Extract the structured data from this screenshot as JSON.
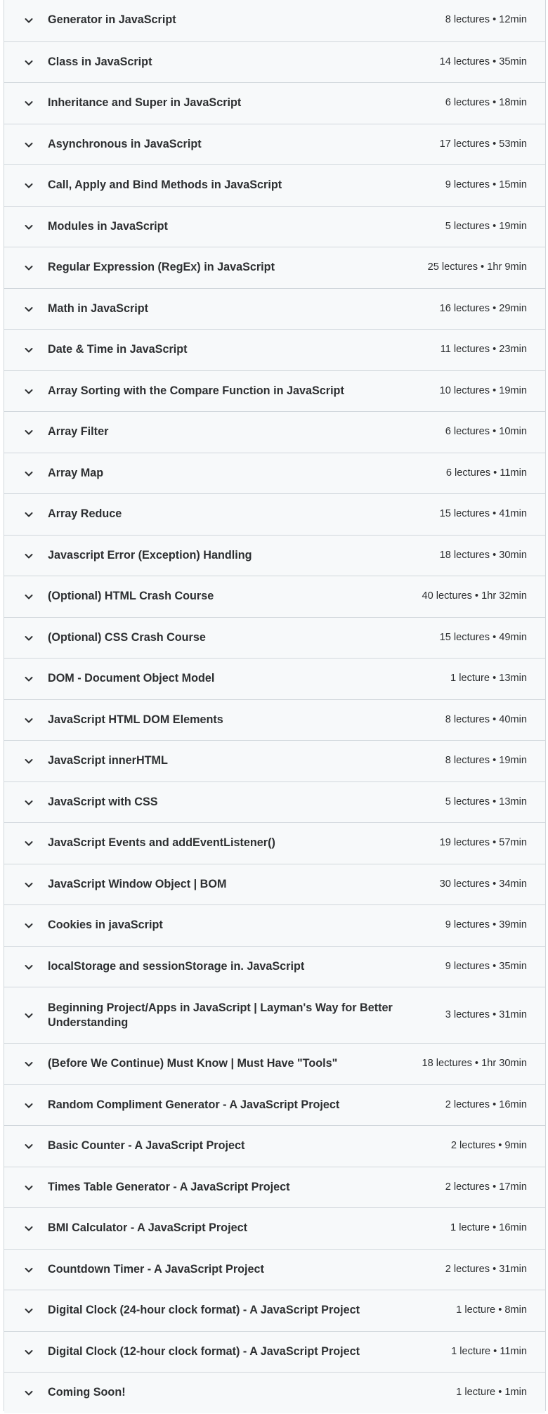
{
  "curriculum": {
    "icon": "chevron-down-icon",
    "sections": [
      {
        "title": "Generator in JavaScript",
        "meta": "8 lectures • 12min"
      },
      {
        "title": "Class in JavaScript",
        "meta": "14 lectures • 35min"
      },
      {
        "title": "Inheritance and Super in JavaScript",
        "meta": "6 lectures • 18min"
      },
      {
        "title": "Asynchronous in JavaScript",
        "meta": "17 lectures • 53min"
      },
      {
        "title": "Call, Apply and Bind Methods in JavaScript",
        "meta": "9 lectures • 15min"
      },
      {
        "title": "Modules in JavaScript",
        "meta": "5 lectures • 19min"
      },
      {
        "title": "Regular Expression (RegEx) in JavaScript",
        "meta": "25 lectures • 1hr 9min"
      },
      {
        "title": "Math in JavaScript",
        "meta": "16 lectures • 29min"
      },
      {
        "title": "Date & Time in JavaScript",
        "meta": "11 lectures • 23min"
      },
      {
        "title": "Array Sorting with the Compare Function in JavaScript",
        "meta": "10 lectures • 19min"
      },
      {
        "title": "Array Filter",
        "meta": "6 lectures • 10min"
      },
      {
        "title": "Array Map",
        "meta": "6 lectures • 11min"
      },
      {
        "title": "Array Reduce",
        "meta": "15 lectures • 41min"
      },
      {
        "title": "Javascript Error (Exception) Handling",
        "meta": "18 lectures • 30min"
      },
      {
        "title": "(Optional) HTML Crash Course",
        "meta": "40 lectures • 1hr 32min"
      },
      {
        "title": "(Optional) CSS Crash Course",
        "meta": "15 lectures • 49min"
      },
      {
        "title": "DOM - Document Object Model",
        "meta": "1 lecture • 13min"
      },
      {
        "title": "JavaScript HTML DOM Elements",
        "meta": "8 lectures • 40min"
      },
      {
        "title": "JavaScript innerHTML",
        "meta": "8 lectures • 19min"
      },
      {
        "title": "JavaScript with CSS",
        "meta": "5 lectures • 13min"
      },
      {
        "title": "JavaScript Events and addEventListener()",
        "meta": "19 lectures • 57min"
      },
      {
        "title": "JavaScript Window Object | BOM",
        "meta": "30 lectures • 34min"
      },
      {
        "title": "Cookies in javaScript",
        "meta": "9 lectures • 39min"
      },
      {
        "title": "localStorage and sessionStorage in. JavaScript",
        "meta": "9 lectures • 35min"
      },
      {
        "title": "Beginning Project/Apps in JavaScript | Layman's Way for Better Understanding",
        "meta": "3 lectures • 31min"
      },
      {
        "title": "(Before We Continue) Must Know | Must Have \"Tools\"",
        "meta": "18 lectures • 1hr 30min"
      },
      {
        "title": "Random Compliment Generator - A JavaScript Project",
        "meta": "2 lectures • 16min"
      },
      {
        "title": "Basic Counter - A JavaScript Project",
        "meta": "2 lectures • 9min"
      },
      {
        "title": "Times Table Generator - A JavaScript Project",
        "meta": "2 lectures • 17min"
      },
      {
        "title": "BMI Calculator - A JavaScript Project",
        "meta": "1 lecture • 16min"
      },
      {
        "title": "Countdown Timer - A JavaScript Project",
        "meta": "2 lectures • 31min"
      },
      {
        "title": "Digital Clock (24-hour clock format) - A JavaScript Project",
        "meta": "1 lecture • 8min"
      },
      {
        "title": "Digital Clock (12-hour clock format) - A JavaScript Project",
        "meta": "1 lecture • 11min"
      },
      {
        "title": "Coming Soon!",
        "meta": "1 lecture • 1min"
      }
    ]
  }
}
